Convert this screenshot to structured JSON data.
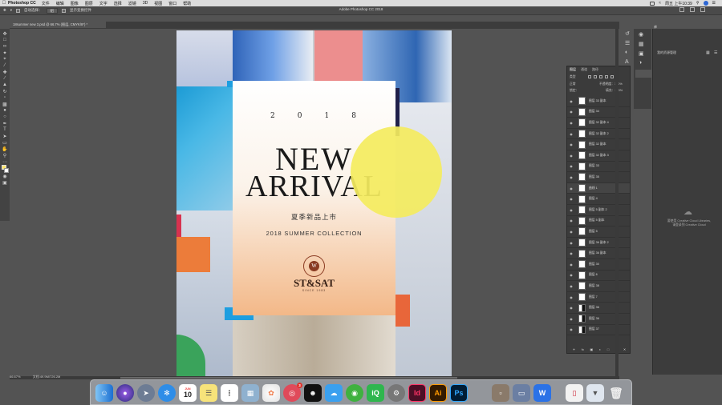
{
  "menubar": {
    "app_name": "Photoshop CC",
    "items": [
      "文件",
      "编辑",
      "图像",
      "图层",
      "文字",
      "选择",
      "滤镜",
      "3D",
      "视图",
      "窗口",
      "帮助"
    ],
    "clock": "周五 上午10:39"
  },
  "window": {
    "title": "Adobe Photoshop CC 2018"
  },
  "options_bar": {
    "auto_select_label": "自动选择：",
    "auto_select_value": "组",
    "transform_label": "显示变换控件"
  },
  "document": {
    "tab": "18summer new 3.psd @ 66.7% (图层, CMYK/8*) *"
  },
  "poster": {
    "year": [
      "2",
      "0",
      "1",
      "8"
    ],
    "title_line1": "NEW",
    "title_line2": "ARRIVAL",
    "subtitle_cn": "夏季新品上市",
    "subtitle_en": "2018 SUMMER COLLECTION",
    "seal_letter": "W",
    "brand": "ST&SAT",
    "brand_tag": "SINCE 1983"
  },
  "layers_panel": {
    "tabs": [
      "图层",
      "通道",
      "路径"
    ],
    "kind_label": "类型",
    "blend_mode": "正常",
    "opacity_label": "不透明度：100%",
    "lock_label": "锁定：",
    "fill_label": "填充：100%",
    "layers": [
      "图层 33 副本",
      "图层 34",
      "图层 32 副本 4",
      "图层 32 副本 2",
      "图层 32 副本",
      "图层 32 副本 3",
      "图层 33",
      "图层 35",
      "曲线 1",
      "图层 4",
      "图层 5 副本 2",
      "图层 5 副本",
      "图层 5",
      "图层 36 副本 2",
      "图层 36 副本",
      "图层 30",
      "图层 6",
      "图层 38",
      "图层 7",
      "图层 36",
      "图层 36",
      "图层 37"
    ]
  },
  "libraries": {
    "title": "库",
    "dropdown": "我的资源管理",
    "cloud_message_1": "要使用 Creative Cloud Libraries,",
    "cloud_message_2": "请登录到 Creative Cloud"
  },
  "statusbar": {
    "zoom": "66.67%",
    "doc_info": "文档:49.9M/726.2M"
  },
  "dock": {
    "calendar_month": "JUN",
    "calendar_day": "10",
    "badge_count": "3"
  }
}
